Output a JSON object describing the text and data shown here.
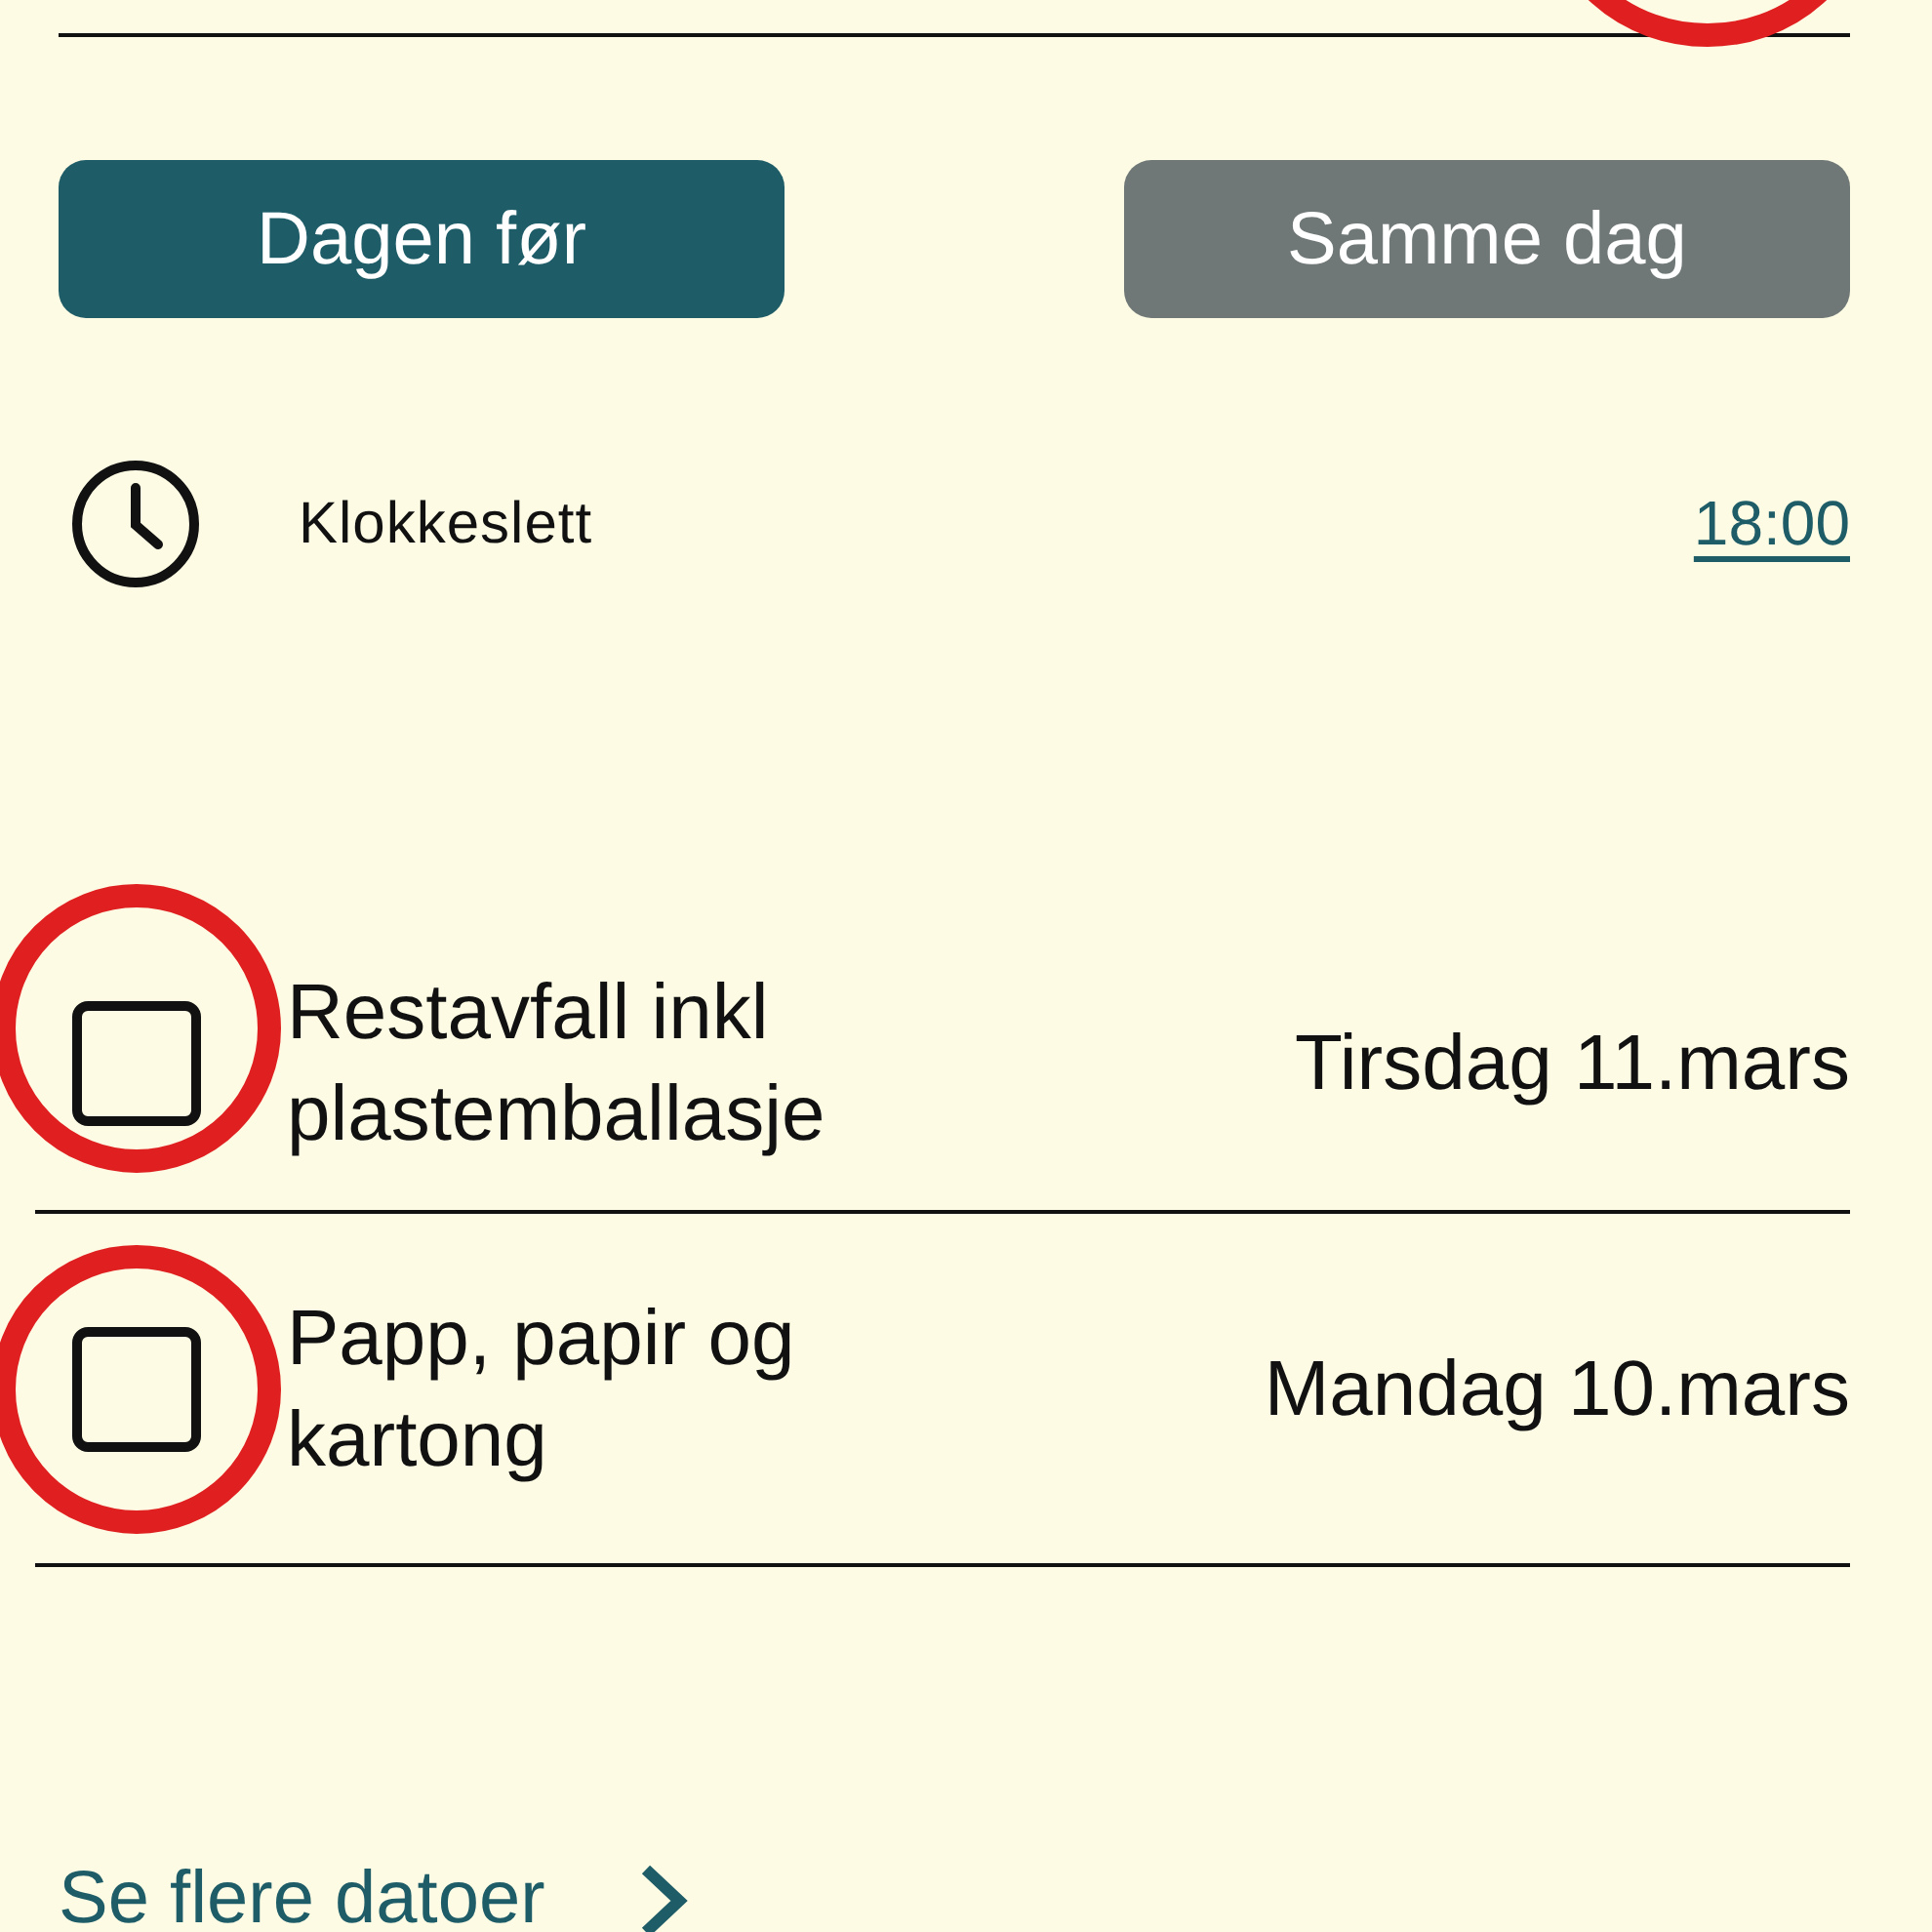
{
  "timing_options": [
    {
      "label": "Dagen før",
      "selected": true
    },
    {
      "label": "Samme dag",
      "selected": false
    }
  ],
  "time_row": {
    "label": "Klokkeslett",
    "value": "18:00"
  },
  "waste_types": [
    {
      "name": "Restavfall inkl plastemballasje",
      "date": "Tirsdag 11.mars",
      "checked": false
    },
    {
      "name": "Papp, papir og kartong",
      "date": "Mandag 10.mars",
      "checked": false
    }
  ],
  "more_link": "Se flere datoer"
}
